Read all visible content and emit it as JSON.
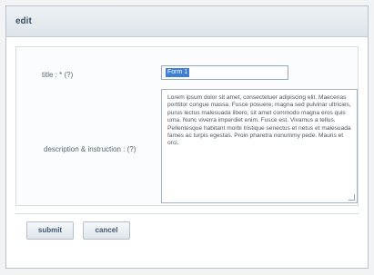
{
  "dialog": {
    "title": "edit"
  },
  "form": {
    "title_label": "title : * (?)",
    "title_value": "Form 1",
    "description_label": "description & instruction : (?)",
    "description_paragraphs": [
      "Lorem ipsum dolor sit amet, consectetuer adipiscing elit. Maecenas porttitor congue massa. Fusce posuere, magna sed pulvinar ultricies, purus lectus malesuada libero, sit amet commodo magna eros quis urna. Nunc viverra imperdiet enim. Fusce est. Vivamus a tellus.",
      "Pellentesque habitant morbi tristique senectus et netus et malesuada fames ac turpis egestas. Proin pharetra nonummy pede. Mauris et orci."
    ]
  },
  "buttons": {
    "submit": "submit",
    "cancel": "cancel"
  }
}
